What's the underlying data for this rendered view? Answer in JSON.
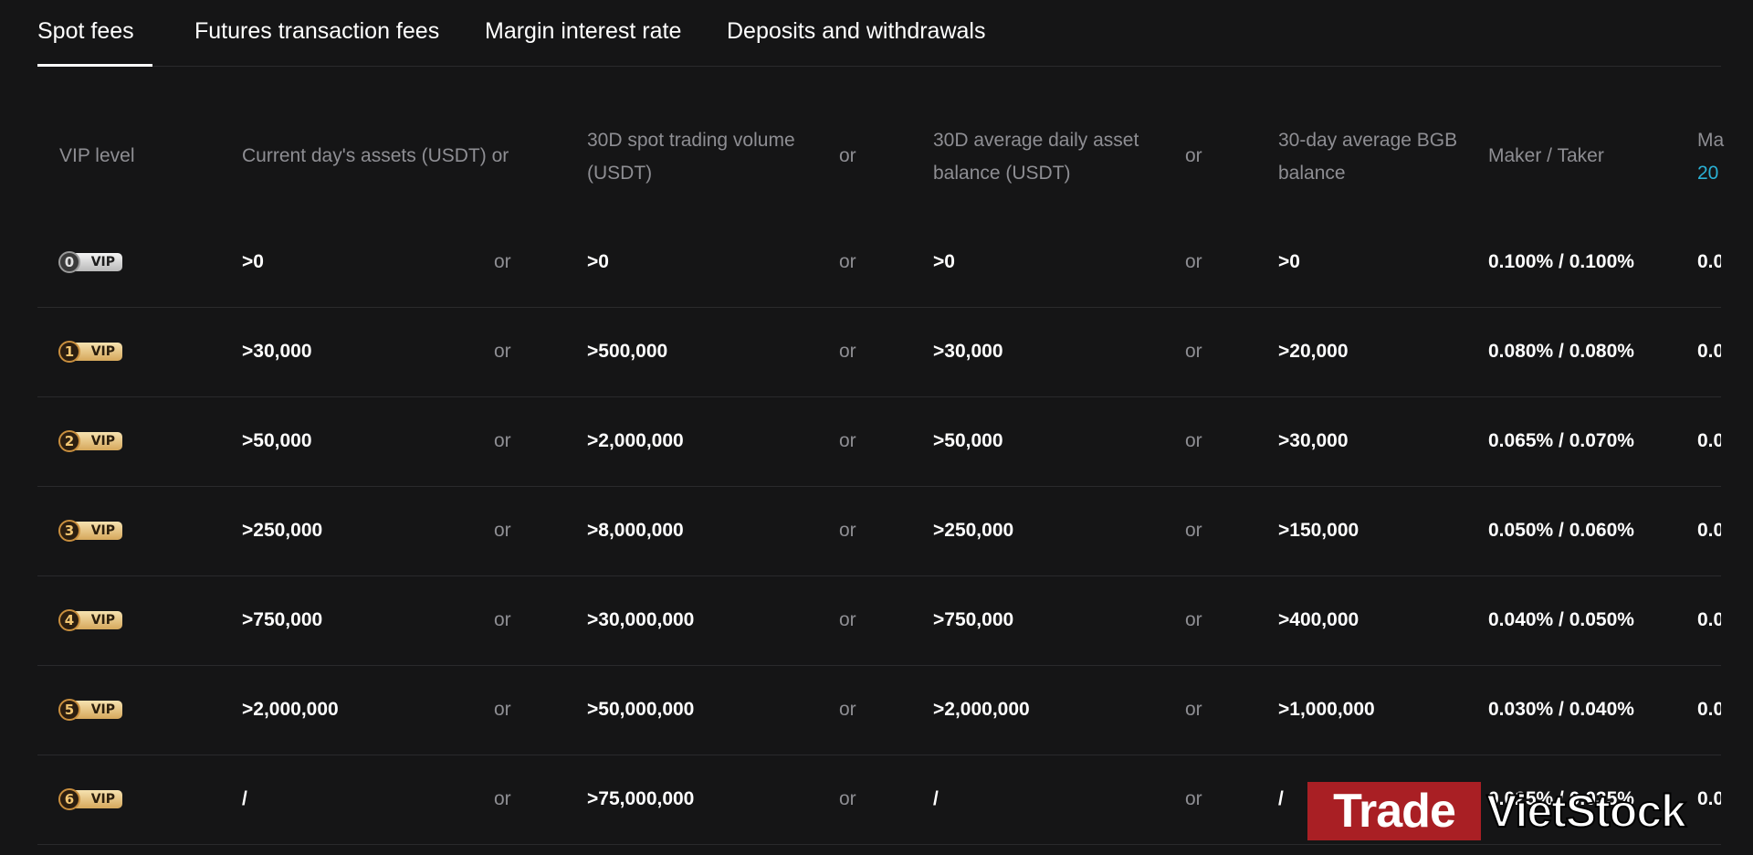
{
  "tabs": [
    {
      "label": "Spot fees",
      "active": true
    },
    {
      "label": "Futures transaction fees",
      "active": false
    },
    {
      "label": "Margin interest rate",
      "active": false
    },
    {
      "label": "Deposits and withdrawals",
      "active": false
    }
  ],
  "table": {
    "headers": {
      "vip_level": "VIP level",
      "assets": "Current day's assets (USDT) or",
      "spot_volume_line1": "30D spot trading volume",
      "spot_volume_line2": "(USDT)",
      "or": "or",
      "avg_balance_line1": "30D average daily asset",
      "avg_balance_line2": "balance (USDT)",
      "bgb_line1": "30-day average BGB",
      "bgb_line2": "balance",
      "maker_taker": "Maker / Taker",
      "cut_col_line1": "Ma",
      "cut_col_line2": "20"
    },
    "badge_text": "VIP",
    "or_text": "or",
    "rows": [
      {
        "level": "0",
        "tier": "silver",
        "assets": ">0",
        "volume": ">0",
        "balance": ">0",
        "bgb": ">0",
        "fees": "0.100% / 0.100%",
        "cut": "0.0"
      },
      {
        "level": "1",
        "tier": "gold",
        "assets": ">30,000",
        "volume": ">500,000",
        "balance": ">30,000",
        "bgb": ">20,000",
        "fees": "0.080% / 0.080%",
        "cut": "0.0"
      },
      {
        "level": "2",
        "tier": "gold",
        "assets": ">50,000",
        "volume": ">2,000,000",
        "balance": ">50,000",
        "bgb": ">30,000",
        "fees": "0.065% / 0.070%",
        "cut": "0.0"
      },
      {
        "level": "3",
        "tier": "gold",
        "assets": ">250,000",
        "volume": ">8,000,000",
        "balance": ">250,000",
        "bgb": ">150,000",
        "fees": "0.050% / 0.060%",
        "cut": "0.0"
      },
      {
        "level": "4",
        "tier": "gold",
        "assets": ">750,000",
        "volume": ">30,000,000",
        "balance": ">750,000",
        "bgb": ">400,000",
        "fees": "0.040% / 0.050%",
        "cut": "0.0"
      },
      {
        "level": "5",
        "tier": "gold",
        "assets": ">2,000,000",
        "volume": ">50,000,000",
        "balance": ">2,000,000",
        "bgb": ">1,000,000",
        "fees": "0.030% / 0.040%",
        "cut": "0.0"
      },
      {
        "level": "6",
        "tier": "gold",
        "assets": "/",
        "volume": ">75,000,000",
        "balance": "/",
        "bgb": "/",
        "fees": "0.025% / 0.035%",
        "cut": "0.0"
      }
    ]
  },
  "watermark": {
    "part1": "Trade",
    "part2": "VietStock"
  },
  "colors": {
    "background": "#151516",
    "muted_text": "#8e8e93",
    "link": "#2ab0d4",
    "vip_gold": "#d6a85c",
    "watermark_red": "#a91f24"
  }
}
